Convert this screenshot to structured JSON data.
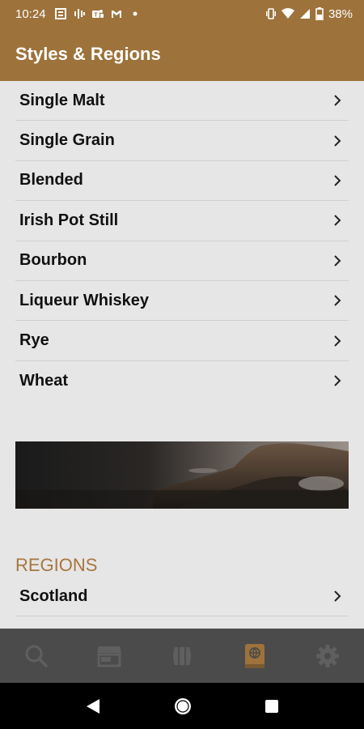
{
  "status_bar": {
    "time": "10:24",
    "battery": "38%",
    "icons_left": [
      "news-icon",
      "podcast-icon",
      "teams-icon",
      "gmail-icon",
      "dot-icon"
    ],
    "icons_right": [
      "vibrate-icon",
      "wifi-icon",
      "signal-icon",
      "battery-icon"
    ]
  },
  "app_bar": {
    "title": "Styles & Regions"
  },
  "styles": {
    "items": [
      {
        "label": "Single Malt"
      },
      {
        "label": "Single Grain"
      },
      {
        "label": "Blended"
      },
      {
        "label": "Irish Pot Still"
      },
      {
        "label": "Bourbon"
      },
      {
        "label": "Liqueur Whiskey"
      },
      {
        "label": "Rye"
      },
      {
        "label": "Wheat"
      }
    ]
  },
  "regions": {
    "header": "REGIONS",
    "items": [
      {
        "label": "Scotland"
      }
    ]
  },
  "tab_bar": {
    "tabs": [
      {
        "icon": "search-icon",
        "active": false
      },
      {
        "icon": "store-icon",
        "active": false
      },
      {
        "icon": "barrel-icon",
        "active": false
      },
      {
        "icon": "book-icon",
        "active": true
      },
      {
        "icon": "gear-icon",
        "active": false
      }
    ]
  },
  "colors": {
    "brand": "#9d723b",
    "accent_text": "#a7763f",
    "tab_inactive": "#5f5f5f",
    "tab_active": "#9d723b"
  }
}
